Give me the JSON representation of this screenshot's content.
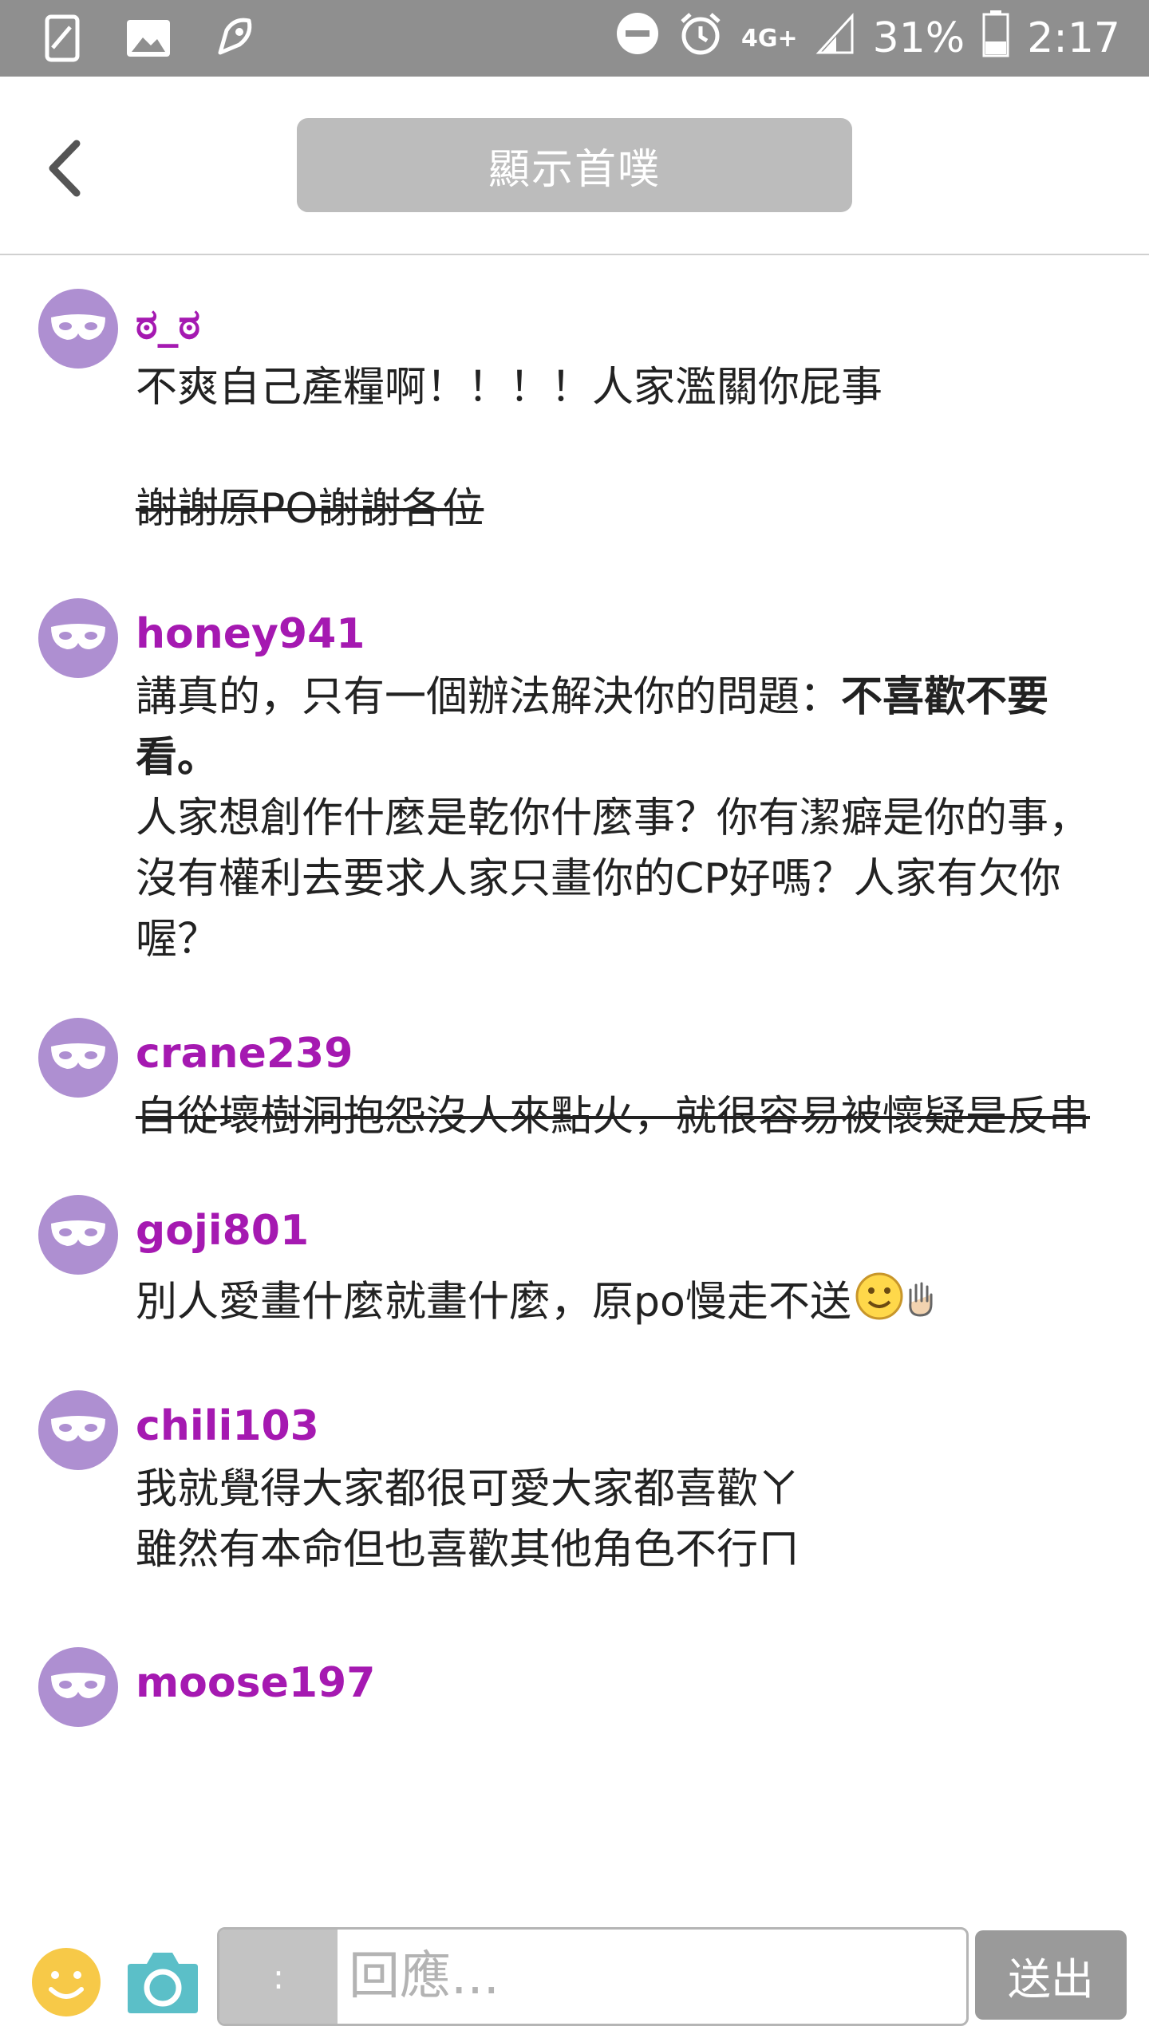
{
  "status_bar": {
    "network": "4G+",
    "battery": "31%",
    "time": "2:17"
  },
  "header": {
    "title": "顯示首噗"
  },
  "comments": [
    {
      "username": "ಠ_ಠ",
      "line1": "不爽自己產糧啊！！！！人家濫關你屁事",
      "line2_strike": "謝謝原PO謝謝各位"
    },
    {
      "username": "honey941",
      "line1_pre": "講真的，只有一個辦法解決你的問題：",
      "line1_bold": "不喜歡不要看。",
      "line2": "人家想創作什麼是乾你什麼事？你有潔癖是你的事，沒有權利去要求人家只畫你的CP好嗎？人家有欠你喔？"
    },
    {
      "username": "crane239",
      "text_strike": "自從壞樹洞抱怨沒人來點火，就很容易被懷疑是反串"
    },
    {
      "username": "goji801",
      "text": "別人愛畫什麼就畫什麼，原po慢走不送"
    },
    {
      "username": "chili103",
      "line1": "我就覺得大家都很可愛大家都喜歡ㄚ",
      "line2": "雖然有本命但也喜歡其他角色不行ㄇ"
    },
    {
      "username": "moose197"
    }
  ],
  "input_bar": {
    "qualifier": ":",
    "placeholder": "回應...",
    "send_label": "送出"
  },
  "colors": {
    "status_bar_bg": "#8f8f8f",
    "avatar": "#ae8fd1",
    "username": "#a519b1",
    "camera": "#5bbfc8",
    "emoji": "#f7c948"
  }
}
